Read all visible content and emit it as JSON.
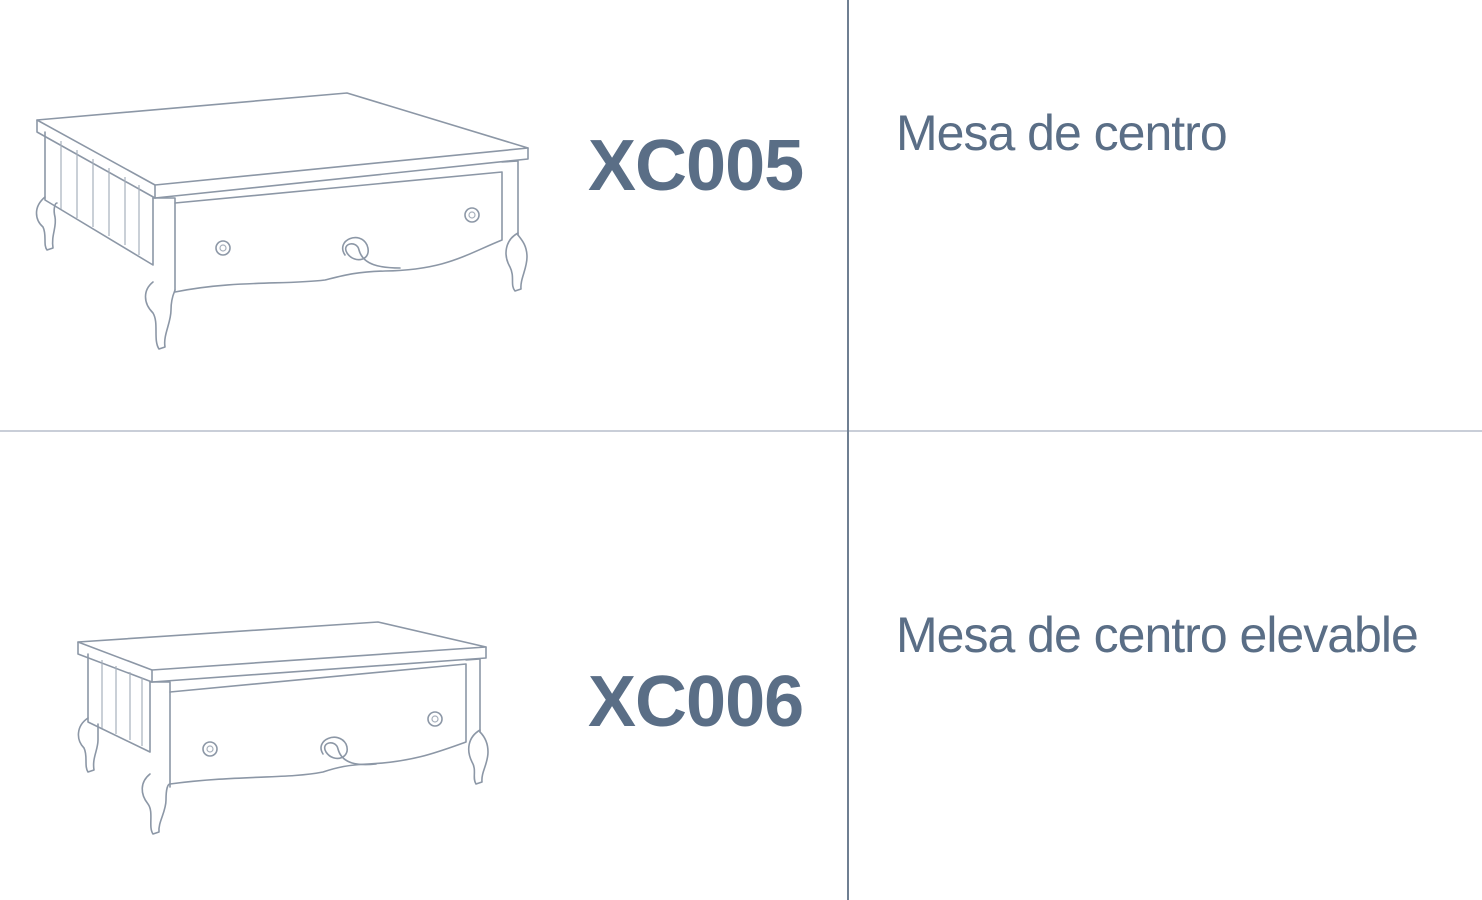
{
  "products": [
    {
      "code": "XC005",
      "description": "Mesa de centro",
      "illustration_icon": "coffee-table-drawing"
    },
    {
      "code": "XC006",
      "description": "Mesa de centro elevable",
      "illustration_icon": "lift-top-coffee-table-drawing"
    }
  ],
  "colors": {
    "text": "#5a6e86",
    "divider_vertical": "#6f7f92",
    "divider_horizontal": "#c9ced8",
    "line_art": "#8c97a6"
  }
}
